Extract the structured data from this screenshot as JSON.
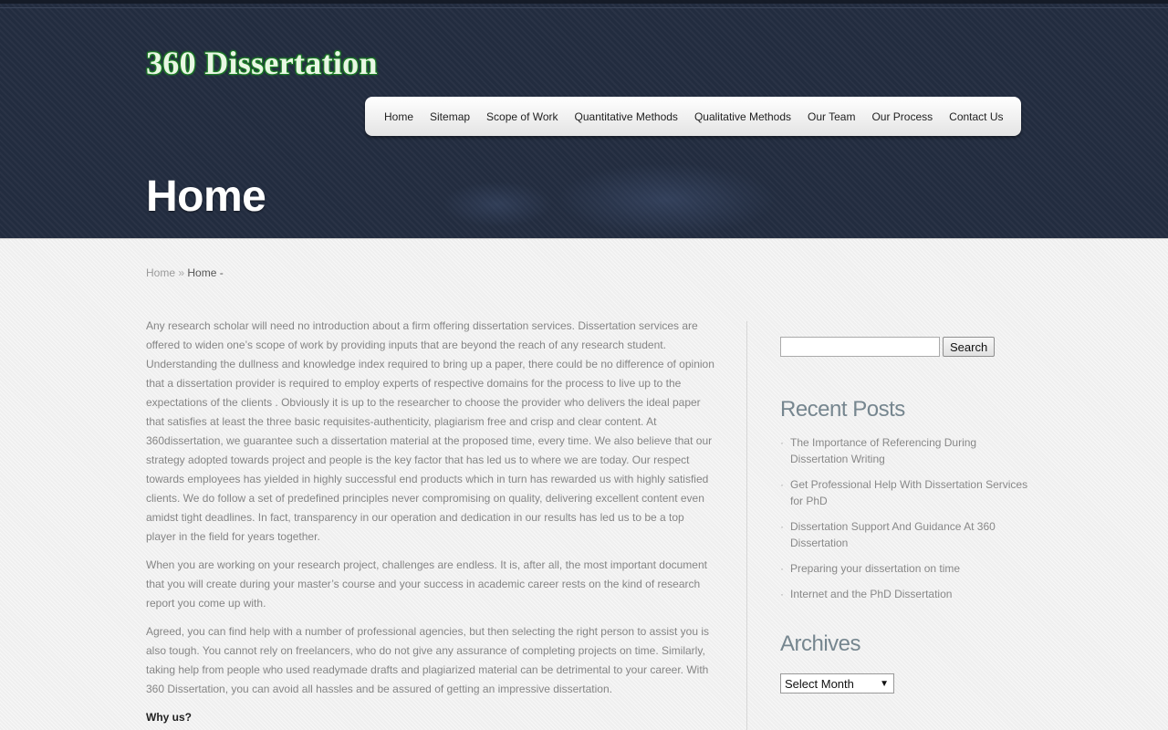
{
  "site": {
    "logo": "360 Dissertation"
  },
  "nav": {
    "items": [
      {
        "label": "Home"
      },
      {
        "label": "Sitemap"
      },
      {
        "label": "Scope of Work"
      },
      {
        "label": "Quantitative Methods"
      },
      {
        "label": "Qualitative Methods"
      },
      {
        "label": "Our Team"
      },
      {
        "label": "Our Process"
      },
      {
        "label": "Contact Us"
      }
    ]
  },
  "page": {
    "title": "Home"
  },
  "breadcrumb": {
    "home": "Home",
    "separator": "»",
    "current": "Home -"
  },
  "content": {
    "paragraphs": [
      "Any research scholar will need no introduction about a firm offering dissertation services. Dissertation services are offered to widen one’s scope of work by providing inputs that are beyond the reach of any research student. Understanding the dullness and knowledge index required to bring up a paper, there could be no difference of opinion that a dissertation provider is required to employ experts of respective domains for the process to live up to the expectations of the clients . Obviously it is up to the researcher to choose the provider who delivers the ideal paper that satisfies at least the three basic requisites-authenticity, plagiarism free and crisp and clear content.  At 360dissertation, we guarantee such a dissertation material at the proposed time, every time. We also believe that our strategy adopted towards project and people is the key factor that has led us to where we are today. Our respect towards employees has yielded in highly successful end products which in turn has rewarded us with highly satisfied clients. We do follow a set of predefined principles never compromising on quality, delivering excellent content even amidst tight deadlines. In fact, transparency in our operation and dedication in our results has led us to be a top player in the field for years together.",
      "When you are working on your research project, challenges are endless. It is, after all, the most important document that you will create during your master’s course and your success in academic career rests on the kind of research report you come up with.",
      "Agreed, you can find help with a number of professional agencies, but then selecting the right person to assist you is also tough. You cannot rely on freelancers, who do not give any assurance of completing projects on time. Similarly, taking help from people who used readymade drafts and plagiarized material can be detrimental to your career. With 360 Dissertation, you can avoid all hassles and be assured of getting an impressive dissertation."
    ],
    "subheading": "Why us?"
  },
  "sidebar": {
    "search": {
      "placeholder": "",
      "value": "",
      "button_label": "Search"
    },
    "recent_posts": {
      "title": "Recent Posts",
      "items": [
        {
          "label": "The Importance of Referencing During Dissertation Writing"
        },
        {
          "label": "Get Professional Help With Dissertation Services for PhD"
        },
        {
          "label": "Dissertation Support And Guidance At 360 Dissertation"
        },
        {
          "label": "Preparing your dissertation on time"
        },
        {
          "label": "Internet and the PhD Dissertation"
        }
      ]
    },
    "archives": {
      "title": "Archives",
      "selected": "Select Month"
    }
  },
  "colors": {
    "header_bg": "#222c3f",
    "widget_title": "#76868f",
    "logo_green": "#1f8a2a"
  }
}
